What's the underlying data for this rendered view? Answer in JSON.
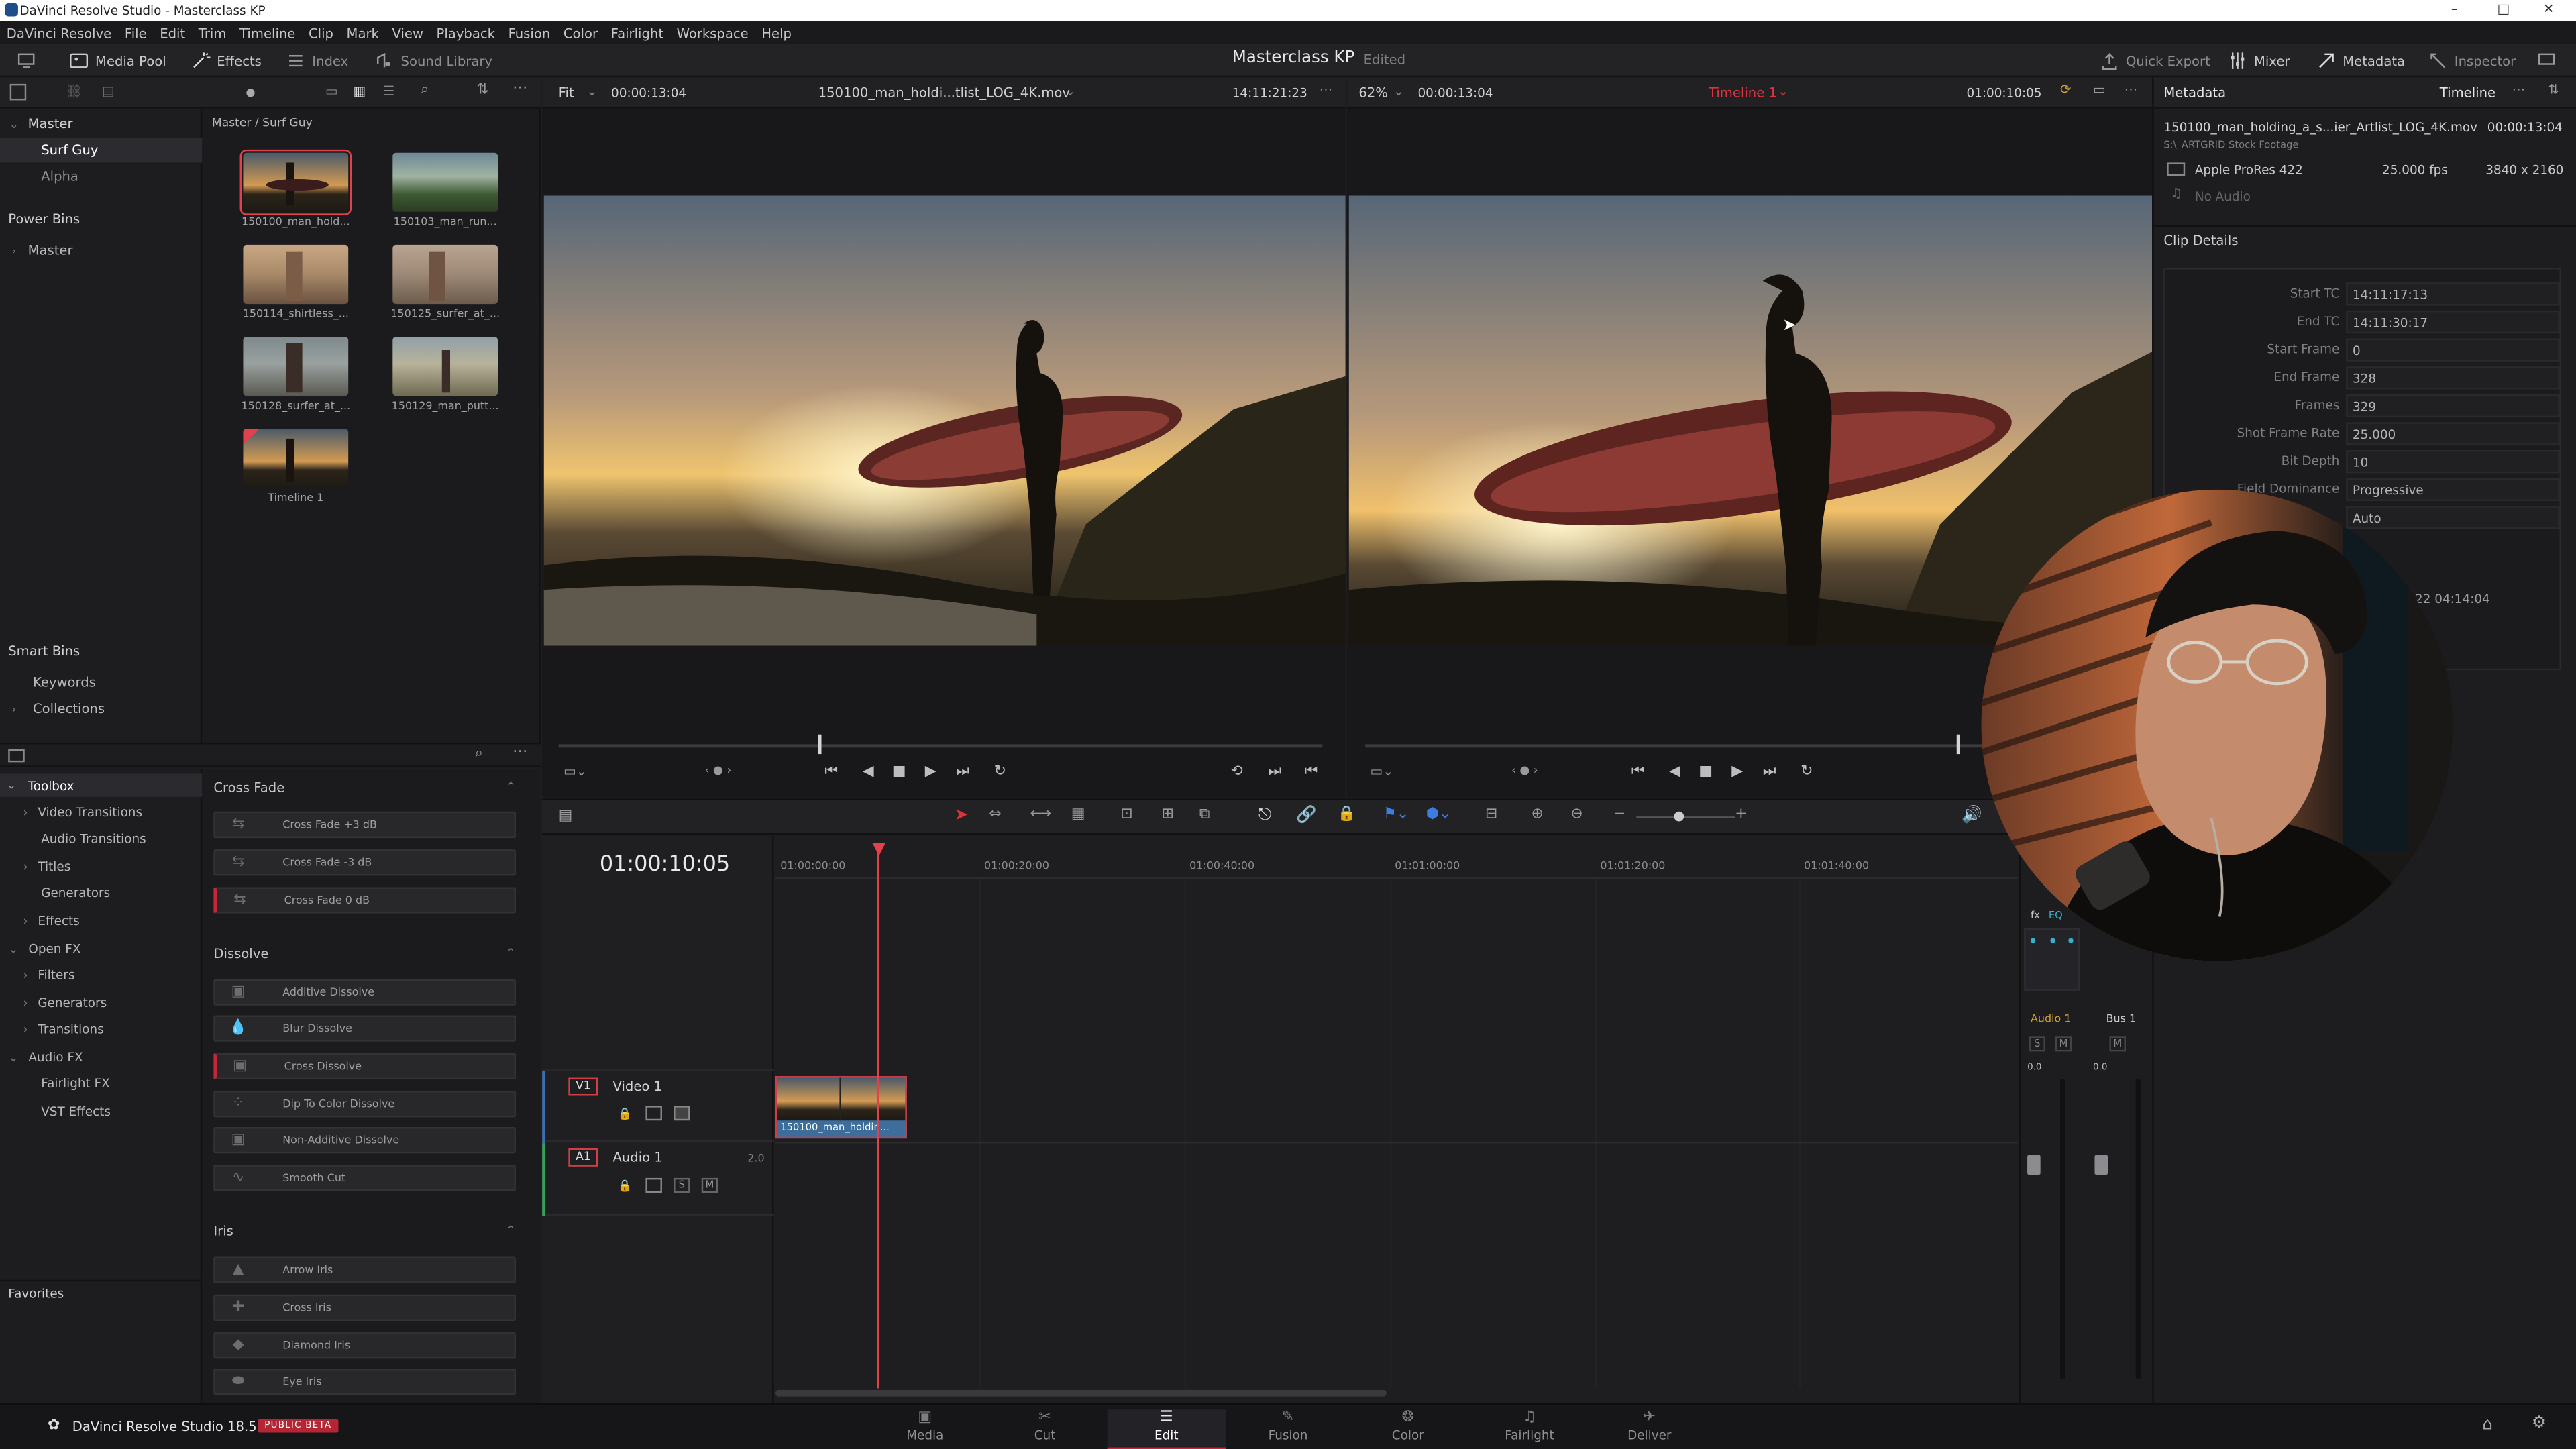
{
  "window": {
    "title": "DaVinci Resolve Studio - Masterclass KP",
    "min": "–",
    "max": "□",
    "close": "✕"
  },
  "menu": [
    "DaVinci Resolve",
    "File",
    "Edit",
    "Trim",
    "Timeline",
    "Clip",
    "Mark",
    "View",
    "Playback",
    "Fusion",
    "Color",
    "Fairlight",
    "Workspace",
    "Help"
  ],
  "toolbar": {
    "media_pool": "Media Pool",
    "effects": "Effects",
    "index": "Index",
    "sound_library": "Sound Library",
    "project": "Masterclass KP",
    "status": "Edited",
    "quick_export": "Quick Export",
    "mixer": "Mixer",
    "metadata": "Metadata",
    "inspector": "Inspector"
  },
  "bins": {
    "master": "Master",
    "items": [
      "Surf Guy",
      "Alpha"
    ],
    "power_bins": "Power Bins",
    "power_master": "Master",
    "smart_bins": "Smart Bins",
    "keywords": "Keywords",
    "collections": "Collections",
    "favorites": "Favorites"
  },
  "media": {
    "path": "Master / Surf Guy",
    "clips": [
      "150100_man_hold...",
      "150103_man_run...",
      "150114_shirtless_...",
      "150125_surfer_at_...",
      "150128_surfer_at_...",
      "150129_man_putt...",
      "Timeline 1"
    ]
  },
  "toolbox": {
    "items": [
      "Toolbox",
      "Video Transitions",
      "Audio Transitions",
      "Titles",
      "Generators",
      "Effects",
      "Open FX",
      "Filters",
      "Generators",
      "Transitions",
      "Audio FX",
      "Fairlight FX",
      "VST Effects"
    ]
  },
  "effects": {
    "cross_fade": "Cross Fade",
    "cross_fade_items": [
      "Cross Fade +3 dB",
      "Cross Fade -3 dB",
      "Cross Fade 0 dB"
    ],
    "dissolve": "Dissolve",
    "dissolve_items": [
      "Additive Dissolve",
      "Blur Dissolve",
      "Cross Dissolve",
      "Dip To Color Dissolve",
      "Non-Additive Dissolve",
      "Smooth Cut"
    ],
    "iris": "Iris",
    "iris_items": [
      "Arrow Iris",
      "Cross Iris",
      "Diamond Iris",
      "Eye Iris"
    ]
  },
  "source_viewer": {
    "fit": "Fit",
    "duration": "00:00:13:04",
    "clip": "150100_man_holdi...tlist_LOG_4K.mov",
    "tc": "14:11:21:23",
    "scrub_position": 0.34
  },
  "timeline_viewer": {
    "zoom": "62%",
    "duration": "00:00:13:04",
    "name": "Timeline 1",
    "tc": "01:00:10:05",
    "scrub_position": 0.77
  },
  "metadata": {
    "tab": "Metadata",
    "mode": "Timeline",
    "clip_name": "150100_man_holding_a_s...ier_Artlist_LOG_4K.mov",
    "duration": "00:00:13:04",
    "path": "S:\\_ARTGRID Stock Footage",
    "codec": "Apple ProRes 422",
    "fps": "25.000 fps",
    "res": "3840 x 2160",
    "audio": "No Audio",
    "section": "Clip Details",
    "fields": [
      {
        "k": "Start TC",
        "v": "14:11:17:13"
      },
      {
        "k": "End TC",
        "v": "14:11:30:17"
      },
      {
        "k": "Start Frame",
        "v": "0"
      },
      {
        "k": "End Frame",
        "v": "328"
      },
      {
        "k": "Frames",
        "v": "329"
      },
      {
        "k": "Shot Frame Rate",
        "v": "25.000"
      },
      {
        "k": "Bit Depth",
        "v": "10"
      },
      {
        "k": "Field Dominance",
        "v": "Progressive"
      },
      {
        "k": "",
        "v": "Auto"
      }
    ],
    "date_fragment": "22 04:14:04"
  },
  "timeline": {
    "timecode": "01:00:10:05",
    "ruler": [
      "01:00:00:00",
      "01:00:20:00",
      "01:00:40:00",
      "01:01:00:00",
      "01:01:20:00",
      "01:01:40:00"
    ],
    "v1_tag": "V1",
    "v1_name": "Video 1",
    "a1_tag": "A1",
    "a1_name": "Audio 1",
    "a1_ch": "2.0",
    "clip_label": "150100_man_holdin..."
  },
  "mixer": {
    "audio1": "Audio 1",
    "bus1": "Bus 1",
    "s": "S",
    "m": "M",
    "db1": "0.0",
    "db2": "0.0",
    "fx": "fx",
    "eq": "EQ"
  },
  "bottom": {
    "brand": "DaVinci Resolve Studio 18.5",
    "badge": "PUBLIC BETA",
    "pages": [
      "Media",
      "Cut",
      "Edit",
      "Fusion",
      "Color",
      "Fairlight",
      "Deliver"
    ],
    "active_page": "Edit"
  },
  "colors": {
    "accent": "#c7273a",
    "playhead": "#e0414b",
    "clip_blue": "#3c6d9b"
  }
}
